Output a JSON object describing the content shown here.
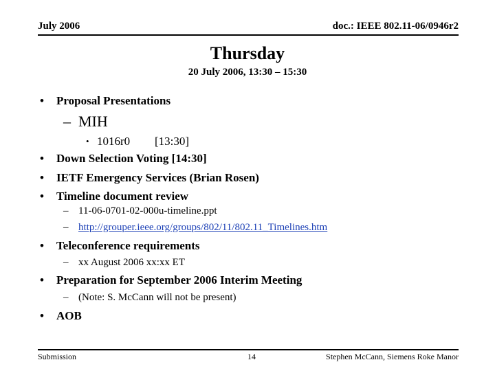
{
  "header": {
    "date": "July 2006",
    "doc_id": "doc.: IEEE 802.11-06/0946r2"
  },
  "title": "Thursday",
  "subtitle": "20 July 2006, 13:30 – 15:30",
  "agenda": {
    "bullet_glyph": "•",
    "dash_glyph": "–",
    "items": [
      {
        "label": "Proposal Presentations",
        "sub": {
          "label": "MIH",
          "items": [
            {
              "label": "1016r0",
              "time": "[13:30]"
            }
          ]
        }
      },
      {
        "label": "Down Selection Voting [14:30]"
      },
      {
        "label": "IETF Emergency Services (Brian Rosen)"
      },
      {
        "label": "Timeline document review",
        "sub_items": [
          {
            "label": "11-06-0701-02-000u-timeline.ppt"
          },
          {
            "label": "http://grouper.ieee.org/groups/802/11/802.11_Timelines.htm",
            "is_link": true
          }
        ]
      },
      {
        "label": "Teleconference requirements",
        "sub_items": [
          {
            "label": "xx August 2006 xx:xx ET"
          }
        ]
      },
      {
        "label": "Preparation for September 2006 Interim Meeting",
        "sub_items": [
          {
            "label": "(Note: S. McCann will not be present)"
          }
        ]
      },
      {
        "label": "AOB"
      }
    ]
  },
  "footer": {
    "left": "Submission",
    "page_number": "14",
    "author": "Stephen McCann, Siemens Roke Manor"
  },
  "colors": {
    "link": "#1b3fb5",
    "text": "#000000",
    "background": "#ffffff"
  }
}
